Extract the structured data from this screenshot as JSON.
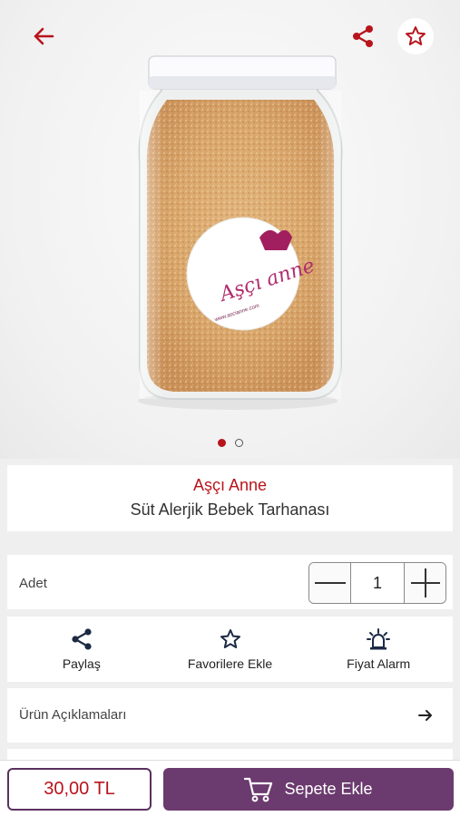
{
  "product": {
    "brand": "Aşçı Anne",
    "name": "Süt Alerjik Bebek Tarhanası",
    "label_logo_text": "Aşçı anne",
    "label_url": "www.ascianne.com"
  },
  "gallery": {
    "current": 1,
    "total": 2
  },
  "quantity": {
    "label": "Adet",
    "value": "1"
  },
  "actions": [
    {
      "label": "Paylaş",
      "icon": "share-icon"
    },
    {
      "label": "Favorilere Ekle",
      "icon": "star-icon"
    },
    {
      "label": "Fiyat Alarm",
      "icon": "alarm-icon"
    }
  ],
  "description": {
    "label": "Ürün Açıklamaları"
  },
  "footer": {
    "price": "30,00 TL",
    "cart_label": "Sepete Ekle"
  },
  "colors": {
    "accent": "#b8141c",
    "purple": "#6b3a6e"
  }
}
